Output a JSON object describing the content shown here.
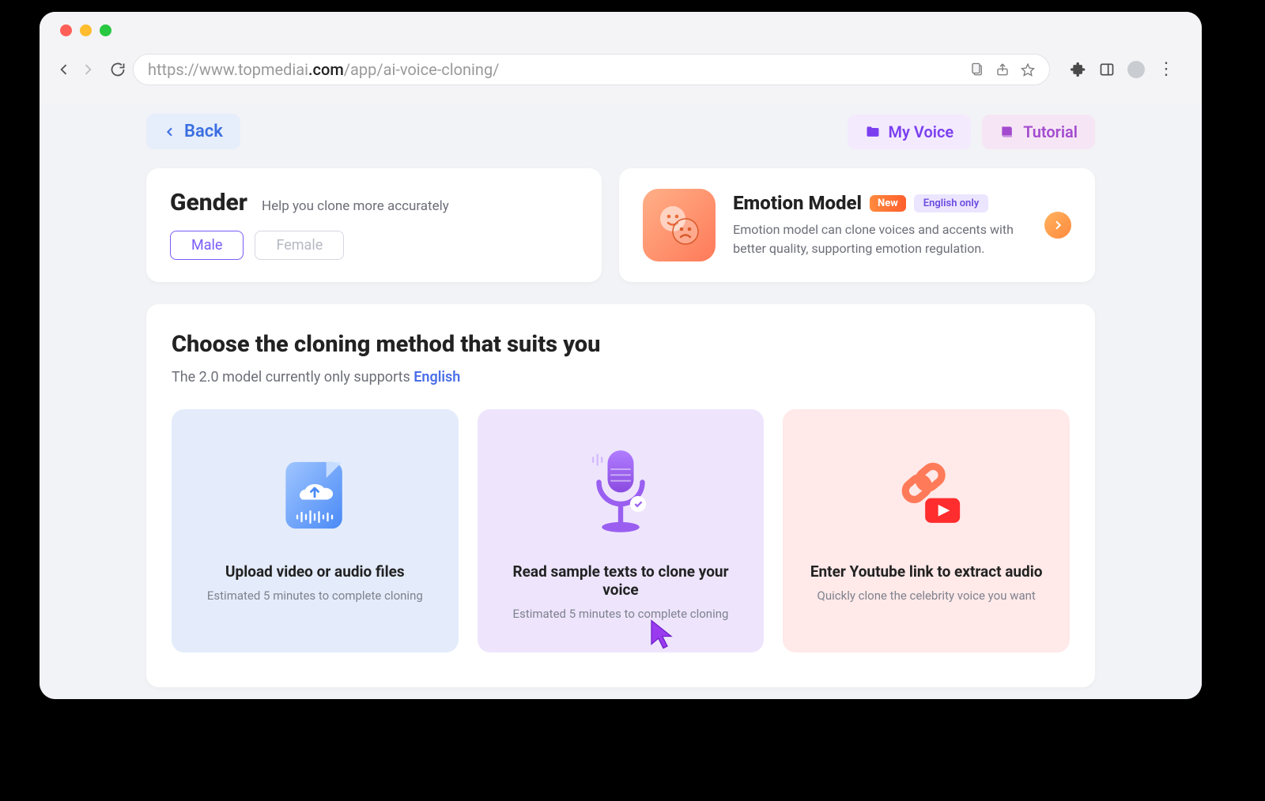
{
  "browser": {
    "url_prefix": "https://www.topmediai",
    "url_domain_suffix": ".com",
    "url_path": "/app/ai-voice-cloning/"
  },
  "header": {
    "back_label": "Back",
    "my_voice_label": "My Voice",
    "tutorial_label": "Tutorial"
  },
  "gender": {
    "title": "Gender",
    "subtitle": "Help you clone more accurately",
    "options": {
      "male": "Male",
      "female": "Female"
    }
  },
  "emotion": {
    "title": "Emotion Model",
    "badge_new": "New",
    "badge_lang": "English only",
    "desc": "Emotion model can clone voices and accents with better quality, supporting emotion regulation."
  },
  "methods": {
    "heading": "Choose the cloning method that suits you",
    "subtext_pre": "The 2.0 model currently only supports ",
    "subtext_lang": "English",
    "cards": {
      "upload": {
        "title_hl": "Upload video or audio",
        "title_rest": " files",
        "desc": "Estimated 5 minutes to complete cloning"
      },
      "read": {
        "title_hl": "Read sample texts",
        "title_rest": " to clone your voice",
        "desc": "Estimated 5 minutes to complete cloning"
      },
      "youtube": {
        "title_pre": "Enter ",
        "title_hl": "Youtube link",
        "title_rest": " to extract audio",
        "desc": "Quickly clone the celebrity voice you want"
      }
    }
  }
}
